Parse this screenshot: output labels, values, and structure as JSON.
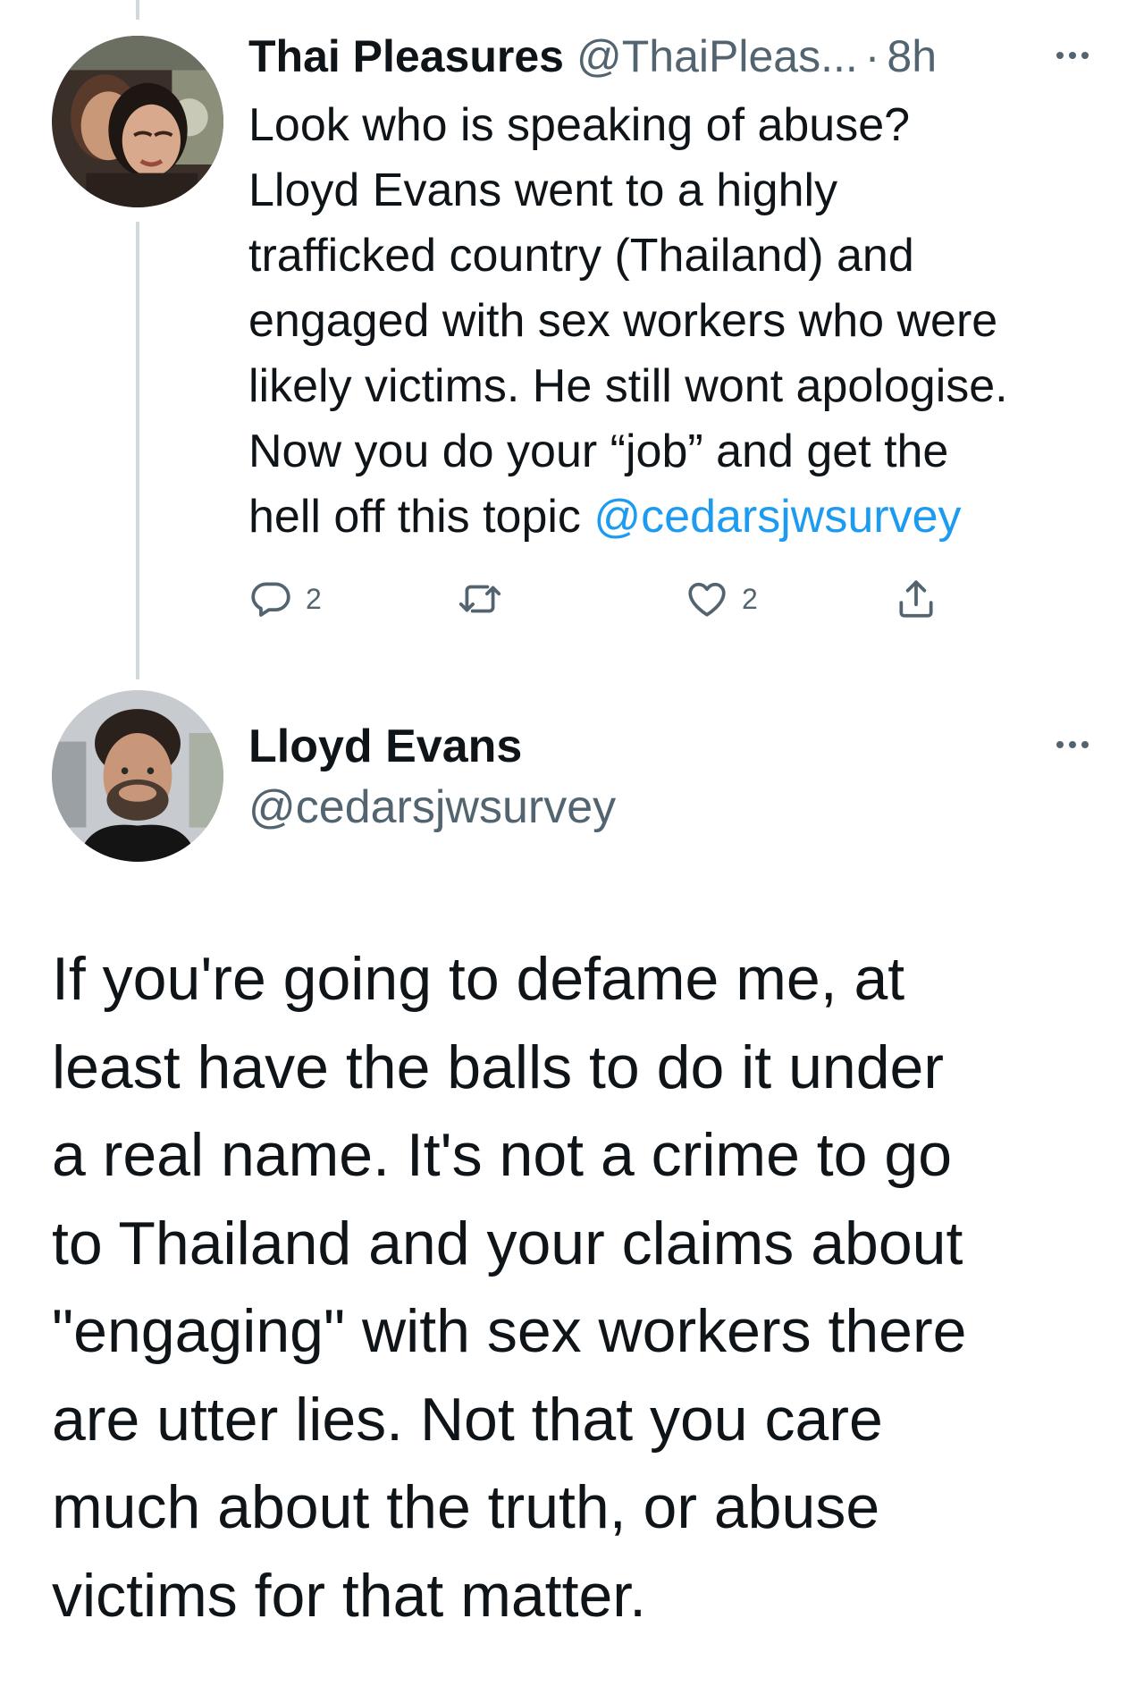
{
  "tweet1": {
    "display_name": "Thai Pleasures",
    "handle": "@ThaiPleas...",
    "separator": "·",
    "time": "8h",
    "text_lines": [
      "Look who is speaking of abuse?",
      "Lloyd Evans went to a highly",
      "trafficked country (Thailand) and",
      "engaged with sex workers who were",
      "likely victims. He still wont apologise.",
      "Now you do your “job” and get the",
      "hell off this topic "
    ],
    "mention": "@cedarsjwsurvey",
    "reply_count": "2",
    "like_count": "2",
    "icons": {
      "avatar": "avatar-photo-couple",
      "more": "more-dots-icon",
      "reply": "reply-icon",
      "retweet": "retweet-icon",
      "like": "heart-icon",
      "share": "share-icon"
    }
  },
  "tweet2": {
    "display_name": "Lloyd Evans",
    "handle": "@cedarsjwsurvey",
    "text_lines": [
      "If you're going to defame me, at",
      "least have the balls to do it under",
      "a real name. It's not a crime to go",
      "to Thailand and your claims about",
      "\"engaging\" with sex workers there",
      "are utter lies. Not that you care",
      "much about the truth, or abuse",
      "victims for that matter."
    ],
    "icons": {
      "avatar": "avatar-photo-man",
      "more": "more-dots-icon"
    }
  },
  "colors": {
    "text": "#0f1419",
    "secondary": "#536471",
    "link": "#1d9bf0",
    "thread_line": "#cfd9de",
    "background": "#ffffff"
  }
}
